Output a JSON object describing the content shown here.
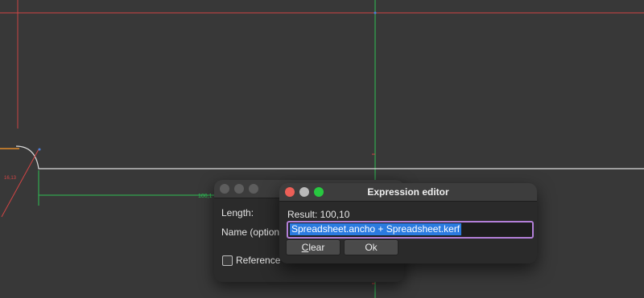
{
  "canvas": {
    "dimension_label": "100,1",
    "marker_label": "16,13"
  },
  "constraint_dialog": {
    "length_label": "Length:",
    "name_label": "Name (optional)",
    "reference_label": "Reference",
    "reference_checked": false
  },
  "expression_editor": {
    "title": "Expression editor",
    "result_text": "Result: 100,10",
    "expression_value": "Spreadsheet.ancho + Spreadsheet.kerf",
    "clear_prefix": "",
    "clear_mnemonic": "C",
    "clear_suffix": "lear",
    "ok_label": "Ok"
  },
  "colors": {
    "canvas_bg": "#383838",
    "focus_border": "#b37fd8",
    "selection": "#2b7be0",
    "axis_red": "#d24545",
    "axis_green": "#2fbf55",
    "geometry": "#dcdcdc",
    "orange": "#e08a2a"
  }
}
